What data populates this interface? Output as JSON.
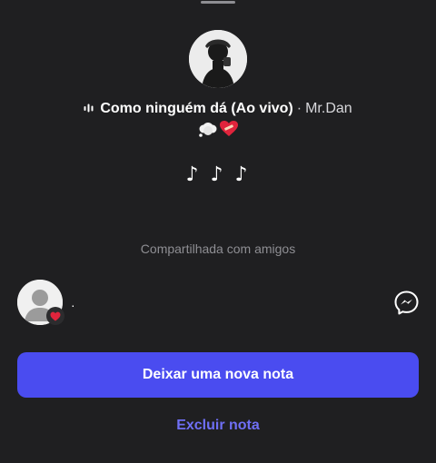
{
  "note": {
    "song_title": "Como ninguém dá (Ao vivo)",
    "separator": "·",
    "artist": "Mr.Dan",
    "emoji_icons": [
      "thought-bubble-icon",
      "mending-heart-icon"
    ],
    "text": "♪ ♪ ♪",
    "visibility_label": "Compartilhada com amigos"
  },
  "viewer": {
    "name": "·",
    "reaction_icon": "heart-icon"
  },
  "actions": {
    "primary_label": "Deixar uma nova nota",
    "delete_label": "Excluir nota"
  },
  "colors": {
    "background": "#1f1f21",
    "primary_button": "#4a4cf0",
    "delete_link": "#6f6ff5",
    "muted_text": "#8e8e93",
    "heart": "#e0243c"
  }
}
